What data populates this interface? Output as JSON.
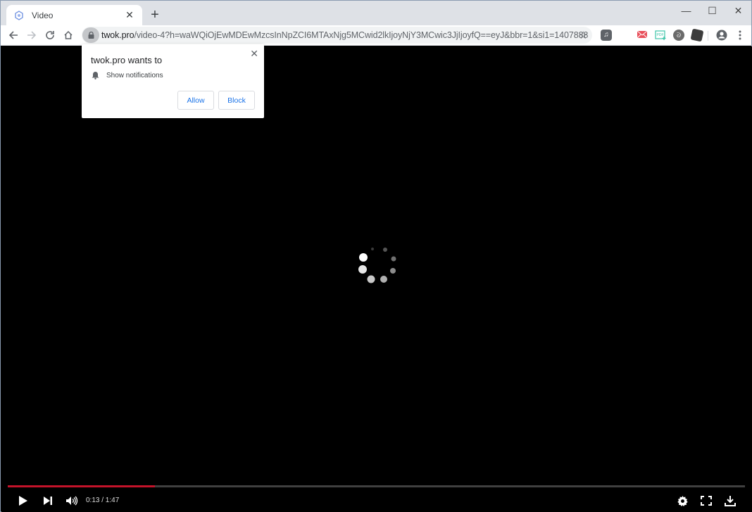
{
  "browser": {
    "tab": {
      "title": "Video",
      "favicon": "site-icon"
    },
    "new_tab_label": "+",
    "window_controls": {
      "minimize": "—",
      "maximize": "☐",
      "close": "✕"
    },
    "url": {
      "host": "twok.pro",
      "path": "/video-4?h=waWQiOjEwMDEwMzcsInNpZCI6MTAxNjg5MCwid2lkIjoyNjY3MCwic3JjIjoyfQ==eyJ&bbr=1&si1=1407888"
    },
    "extensions": [
      "music-extension-icon",
      "mail-extension-icon",
      "pdf-extension-icon",
      "circular-extension-icon",
      "dark-extension-icon"
    ]
  },
  "permission_popup": {
    "title": "twok.pro wants to",
    "permission": "Show notifications",
    "allow_label": "Allow",
    "block_label": "Block",
    "close_label": "✕"
  },
  "player": {
    "current_time": "0:13",
    "duration": "1:47",
    "time_display": "0:13 / 1:47",
    "progress_fraction": 0.2,
    "colors": {
      "progress": "#c4132a",
      "track": "#404040"
    }
  }
}
